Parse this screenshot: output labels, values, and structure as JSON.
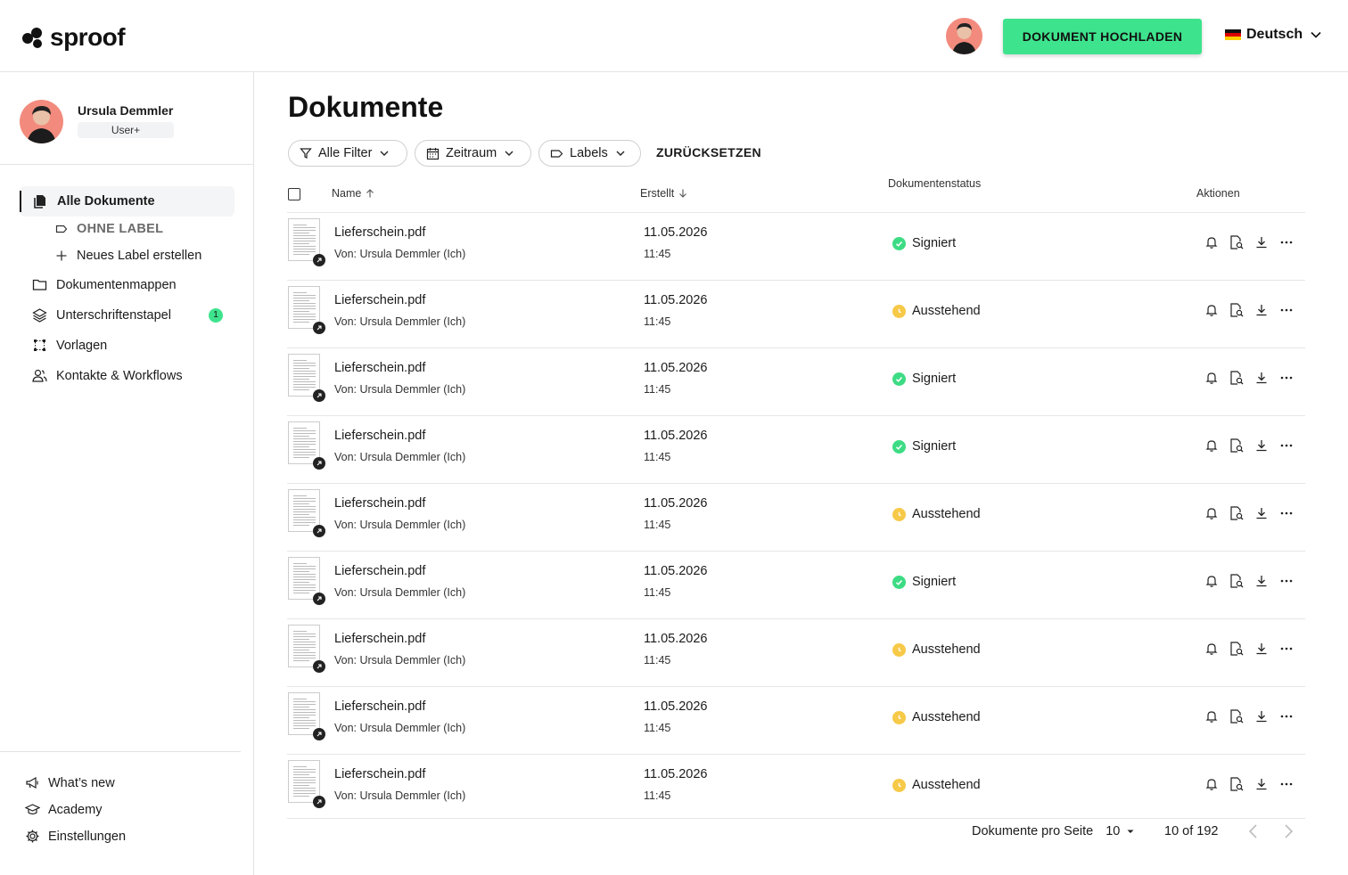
{
  "header": {
    "logo_text": "sproof",
    "upload_label": "DOKUMENT HOCHLADEN",
    "language": "Deutsch"
  },
  "user": {
    "name": "Ursula Demmler",
    "role": "User+"
  },
  "sidebar": {
    "items": [
      {
        "label": "Alle Dokumente",
        "icon": "documents-icon"
      },
      {
        "label": "OHNE LABEL",
        "icon": "label-icon"
      },
      {
        "label": "Neues Label erstellen",
        "icon": "plus-icon"
      },
      {
        "label": "Dokumentenmappen",
        "icon": "folder-icon"
      },
      {
        "label": "Unterschriftenstapel",
        "icon": "layers-icon",
        "badge": "1"
      },
      {
        "label": "Vorlagen",
        "icon": "template-icon"
      },
      {
        "label": "Kontakte & Workflows",
        "icon": "contacts-icon"
      }
    ],
    "bottom": [
      {
        "label": "What’s new",
        "icon": "megaphone-icon"
      },
      {
        "label": "Academy",
        "icon": "graduation-cap-icon"
      },
      {
        "label": "Einstellungen",
        "icon": "gear-icon"
      }
    ]
  },
  "main": {
    "title": "Dokumente",
    "filters": {
      "all": "Alle Filter",
      "period": "Zeitraum",
      "labels": "Labels",
      "reset": "ZURÜCKSETZEN"
    },
    "columns": {
      "name": "Name",
      "created": "Erstellt",
      "status": "Dokumentenstatus",
      "actions": "Aktionen"
    },
    "rows": [
      {
        "name": "Lieferschein.pdf",
        "by": "Von: Ursula Demmler (Ich)",
        "date": "11.05.2026",
        "time": "11:45",
        "status": "Signiert"
      },
      {
        "name": "Lieferschein.pdf",
        "by": "Von: Ursula Demmler (Ich)",
        "date": "11.05.2026",
        "time": "11:45",
        "status": "Ausstehend"
      },
      {
        "name": "Lieferschein.pdf",
        "by": "Von: Ursula Demmler (Ich)",
        "date": "11.05.2026",
        "time": "11:45",
        "status": "Signiert"
      },
      {
        "name": "Lieferschein.pdf",
        "by": "Von: Ursula Demmler (Ich)",
        "date": "11.05.2026",
        "time": "11:45",
        "status": "Signiert"
      },
      {
        "name": "Lieferschein.pdf",
        "by": "Von: Ursula Demmler (Ich)",
        "date": "11.05.2026",
        "time": "11:45",
        "status": "Ausstehend"
      },
      {
        "name": "Lieferschein.pdf",
        "by": "Von: Ursula Demmler (Ich)",
        "date": "11.05.2026",
        "time": "11:45",
        "status": "Signiert"
      },
      {
        "name": "Lieferschein.pdf",
        "by": "Von: Ursula Demmler (Ich)",
        "date": "11.05.2026",
        "time": "11:45",
        "status": "Ausstehend"
      },
      {
        "name": "Lieferschein.pdf",
        "by": "Von: Ursula Demmler (Ich)",
        "date": "11.05.2026",
        "time": "11:45",
        "status": "Ausstehend"
      },
      {
        "name": "Lieferschein.pdf",
        "by": "Von: Ursula Demmler (Ich)",
        "date": "11.05.2026",
        "time": "11:45",
        "status": "Ausstehend"
      }
    ],
    "pagination": {
      "per_page_label": "Dokumente pro Seite",
      "per_page": "10",
      "range": "10 of 192"
    }
  },
  "colors": {
    "accent": "#3ee48d",
    "signed": "#3ddc84",
    "pending": "#f7c948"
  }
}
